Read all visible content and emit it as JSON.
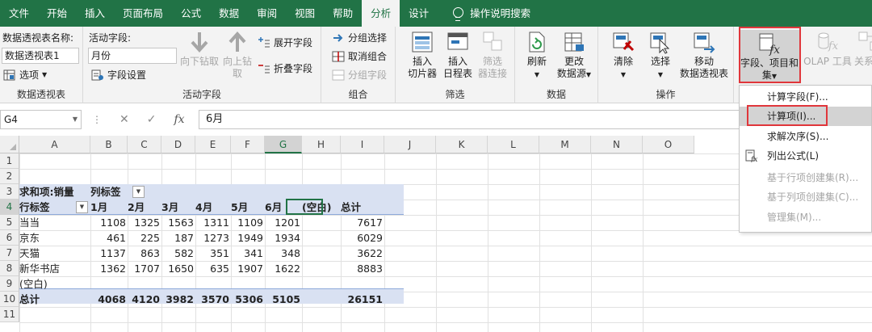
{
  "tabs": [
    "文件",
    "开始",
    "插入",
    "页面布局",
    "公式",
    "数据",
    "审阅",
    "视图",
    "帮助",
    "分析",
    "设计"
  ],
  "active_tab": "分析",
  "tell_me": "操作说明搜索",
  "ribbon": {
    "pivot": {
      "name_label": "数据透视表名称:",
      "name_value": "数据透视表1",
      "options": "选项",
      "group": "数据透视表"
    },
    "active_field": {
      "label": "活动字段:",
      "value": "月份",
      "settings": "字段设置",
      "drill_down_1": "向下钻取",
      "drill_up_1": "向上钻",
      "drill_up_2": "取",
      "expand": "展开字段",
      "collapse": "折叠字段",
      "group": "活动字段"
    },
    "grouping": {
      "group_selection": "分组选择",
      "ungroup": "取消组合",
      "group_field": "分组字段",
      "group": "组合"
    },
    "filter": {
      "slicer_1": "插入",
      "slicer_2": "切片器",
      "timeline_1": "插入",
      "timeline_2": "日程表",
      "filter_conn_1": "筛选",
      "filter_conn_2": "器连接",
      "group": "筛选"
    },
    "data": {
      "refresh": "刷新",
      "change_1": "更改",
      "change_2": "数据源",
      "group": "数据"
    },
    "actions": {
      "clear": "清除",
      "select": "选择",
      "move_1": "移动",
      "move_2": "数据透视表",
      "group": "操作"
    },
    "calc": {
      "fields_1": "字段、项目和",
      "fields_2": "集",
      "olap": "OLAP 工具",
      "relations": "关系"
    }
  },
  "formula_bar": {
    "name_box": "G4",
    "fx": "fx",
    "content": "6月"
  },
  "columns": [
    "A",
    "B",
    "C",
    "D",
    "E",
    "F",
    "G",
    "H",
    "I",
    "J",
    "K",
    "L",
    "M",
    "N",
    "O"
  ],
  "selected_column": "G",
  "rows": [
    "1",
    "2",
    "3",
    "4",
    "5",
    "6",
    "7",
    "8",
    "9",
    "10",
    "11"
  ],
  "selected_row": "4",
  "pivot": {
    "sum_label": "求和项:销量",
    "col_label": "列标签",
    "row_label": "行标签",
    "months": [
      "1月",
      "2月",
      "3月",
      "4月",
      "5月",
      "6月",
      "(空白)",
      "总计"
    ],
    "data_rows": [
      {
        "label": "当当",
        "values": [
          "1108",
          "1325",
          "1563",
          "1311",
          "1109",
          "1201",
          "",
          "7617"
        ]
      },
      {
        "label": "京东",
        "values": [
          "461",
          "225",
          "187",
          "1273",
          "1949",
          "1934",
          "",
          "6029"
        ]
      },
      {
        "label": "天猫",
        "values": [
          "1137",
          "863",
          "582",
          "351",
          "341",
          "348",
          "",
          "3622"
        ]
      },
      {
        "label": "新华书店",
        "values": [
          "1362",
          "1707",
          "1650",
          "635",
          "1907",
          "1622",
          "",
          "8883"
        ]
      },
      {
        "label": "(空白)",
        "values": [
          "",
          "",
          "",
          "",
          "",
          "",
          "",
          ""
        ]
      }
    ],
    "total_row": {
      "label": "总计",
      "values": [
        "4068",
        "4120",
        "3982",
        "3570",
        "5306",
        "5105",
        "",
        "26151"
      ]
    }
  },
  "menu": {
    "items": [
      {
        "label": "计算字段(F)...",
        "disabled": false
      },
      {
        "label": "计算项(I)...",
        "disabled": false
      },
      {
        "label": "求解次序(S)...",
        "disabled": false
      },
      {
        "label": "列出公式(L)",
        "disabled": false
      },
      {
        "label": "基于行项创建集(R)...",
        "disabled": true
      },
      {
        "label": "基于列项创建集(C)...",
        "disabled": true
      },
      {
        "label": "管理集(M)...",
        "disabled": true
      }
    ]
  },
  "colors": {
    "excel_green": "#217346",
    "highlight_red": "#e0363b",
    "pivot_band": "#d9e1f2"
  }
}
